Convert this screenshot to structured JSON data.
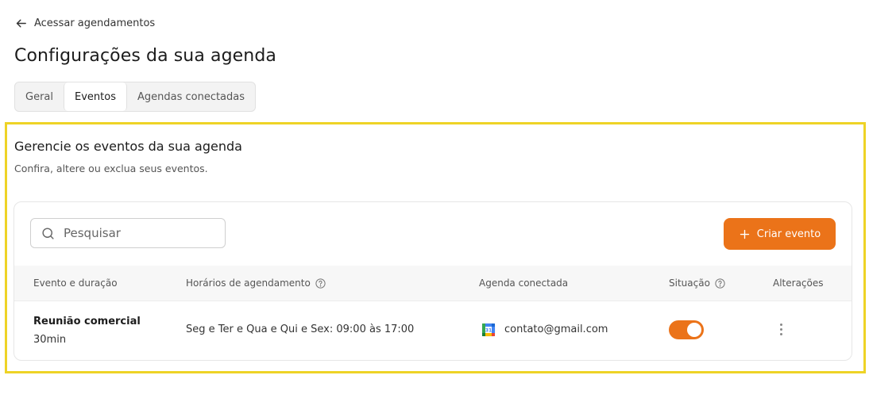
{
  "nav": {
    "back_label": "Acessar agendamentos"
  },
  "page": {
    "title": "Configurações da sua agenda"
  },
  "tabs": [
    {
      "label": "Geral",
      "active": false
    },
    {
      "label": "Eventos",
      "active": true
    },
    {
      "label": "Agendas conectadas",
      "active": false
    }
  ],
  "section": {
    "title": "Gerencie os eventos da sua agenda",
    "subtitle": "Confira, altere ou exclua seus eventos."
  },
  "toolbar": {
    "search_placeholder": "Pesquisar",
    "search_value": "",
    "create_label": "Criar evento"
  },
  "table": {
    "columns": [
      "Evento e duração",
      "Horários de agendamento",
      "Agenda conectada",
      "Situação",
      "Alterações"
    ],
    "rows": [
      {
        "name": "Reunião comercial",
        "duration": "30min",
        "schedule": "Seg e Ter e Qua e Qui e Sex: 09:00 às 17:00",
        "calendar_icon": "google-calendar-icon",
        "calendar_account": "contato@gmail.com",
        "active": true
      }
    ]
  },
  "colors": {
    "accent": "#eb7319",
    "highlight_border": "#eed326",
    "header_bg": "#f7f7f7"
  }
}
